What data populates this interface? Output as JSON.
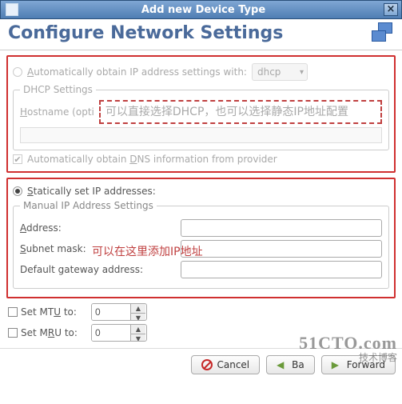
{
  "window": {
    "title": "Add new Device Type",
    "header": "Configure Network Settings"
  },
  "auto": {
    "radio_label_pre": "A",
    "radio_label": "utomatically obtain IP address settings with:",
    "dhcp_option": "dhcp",
    "fieldset": "DHCP Settings",
    "hostname_pre": "H",
    "hostname_label": "ostname (opti",
    "dns_checked": true,
    "dns_pre": "Automatically obtain ",
    "dns_u": "D",
    "dns_post": "NS information from provider"
  },
  "annotations": {
    "top_box": "可以直接选择DHCP，也可以选择静态IP地址配置",
    "manual": "可以在这里添加IP地址"
  },
  "static": {
    "radio_pre": "S",
    "radio_label": "tatically set IP addresses:",
    "fieldset": "Manual IP Address Settings",
    "address_pre": "A",
    "address_label": "ddress:",
    "subnet_pre": "S",
    "subnet_label": "ubnet mask:",
    "gateway_label": "Default gateway address:",
    "address_val": "",
    "subnet_val": "",
    "gateway_val": ""
  },
  "mtu": {
    "label_pre": "Set MT",
    "label_u": "U",
    "label_post": " to:",
    "value": "0"
  },
  "mru": {
    "label_pre": "Set M",
    "label_u": "R",
    "label_post": "U to:",
    "value": "0"
  },
  "buttons": {
    "cancel": "Cancel",
    "back_pre": "Ba",
    "back_u": "",
    "forward": "Forward"
  },
  "watermark": {
    "line1": "51CTO.com",
    "line2": "技术博客"
  }
}
